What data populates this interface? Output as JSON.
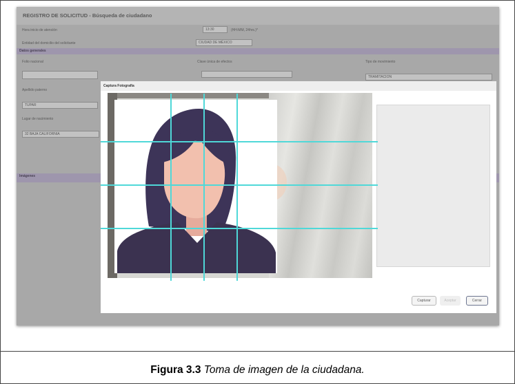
{
  "header": {
    "title": "REGISTRO DE SOLICITUD - Búsqueda de ciudadano"
  },
  "background_form": {
    "hora_label": "Hora inicio de atención",
    "hora_value": "13:30",
    "hora_hint": "(HH:MM, 24hrs.)*",
    "entidad_label": "Entidad del domicilio del solicitante",
    "entidad_value": "CIUDAD DE MÉXICO",
    "section_datos": "Datos generales",
    "folio_label": "Folio nacional",
    "curp_label": "Clave única de efectos",
    "tipo_label": "Tipo de movimiento",
    "tipo_value": "TRAMITACION",
    "apellido_label": "Apellido paterno",
    "apellido_value": "TUPAR",
    "lugar_label": "Lugar de nacimiento",
    "lugar_value": "32 BAJA CALIFORNIA",
    "section_imagenes": "Imágenes"
  },
  "modal": {
    "title": "Captura Fotografía",
    "capture_label": "Capturar",
    "accept_label": "Aceptar",
    "cancel_label": "Cerrar"
  },
  "caption": {
    "figure_number": "Figura 3.3",
    "figure_text": "Toma de imagen de la ciudadana."
  },
  "colors": {
    "grid_line": "#4fd8d8",
    "hair": "#3d3458",
    "skin": "#f2c0ae",
    "shirt": "#3b3250",
    "section_bar": "#9e96ad"
  }
}
